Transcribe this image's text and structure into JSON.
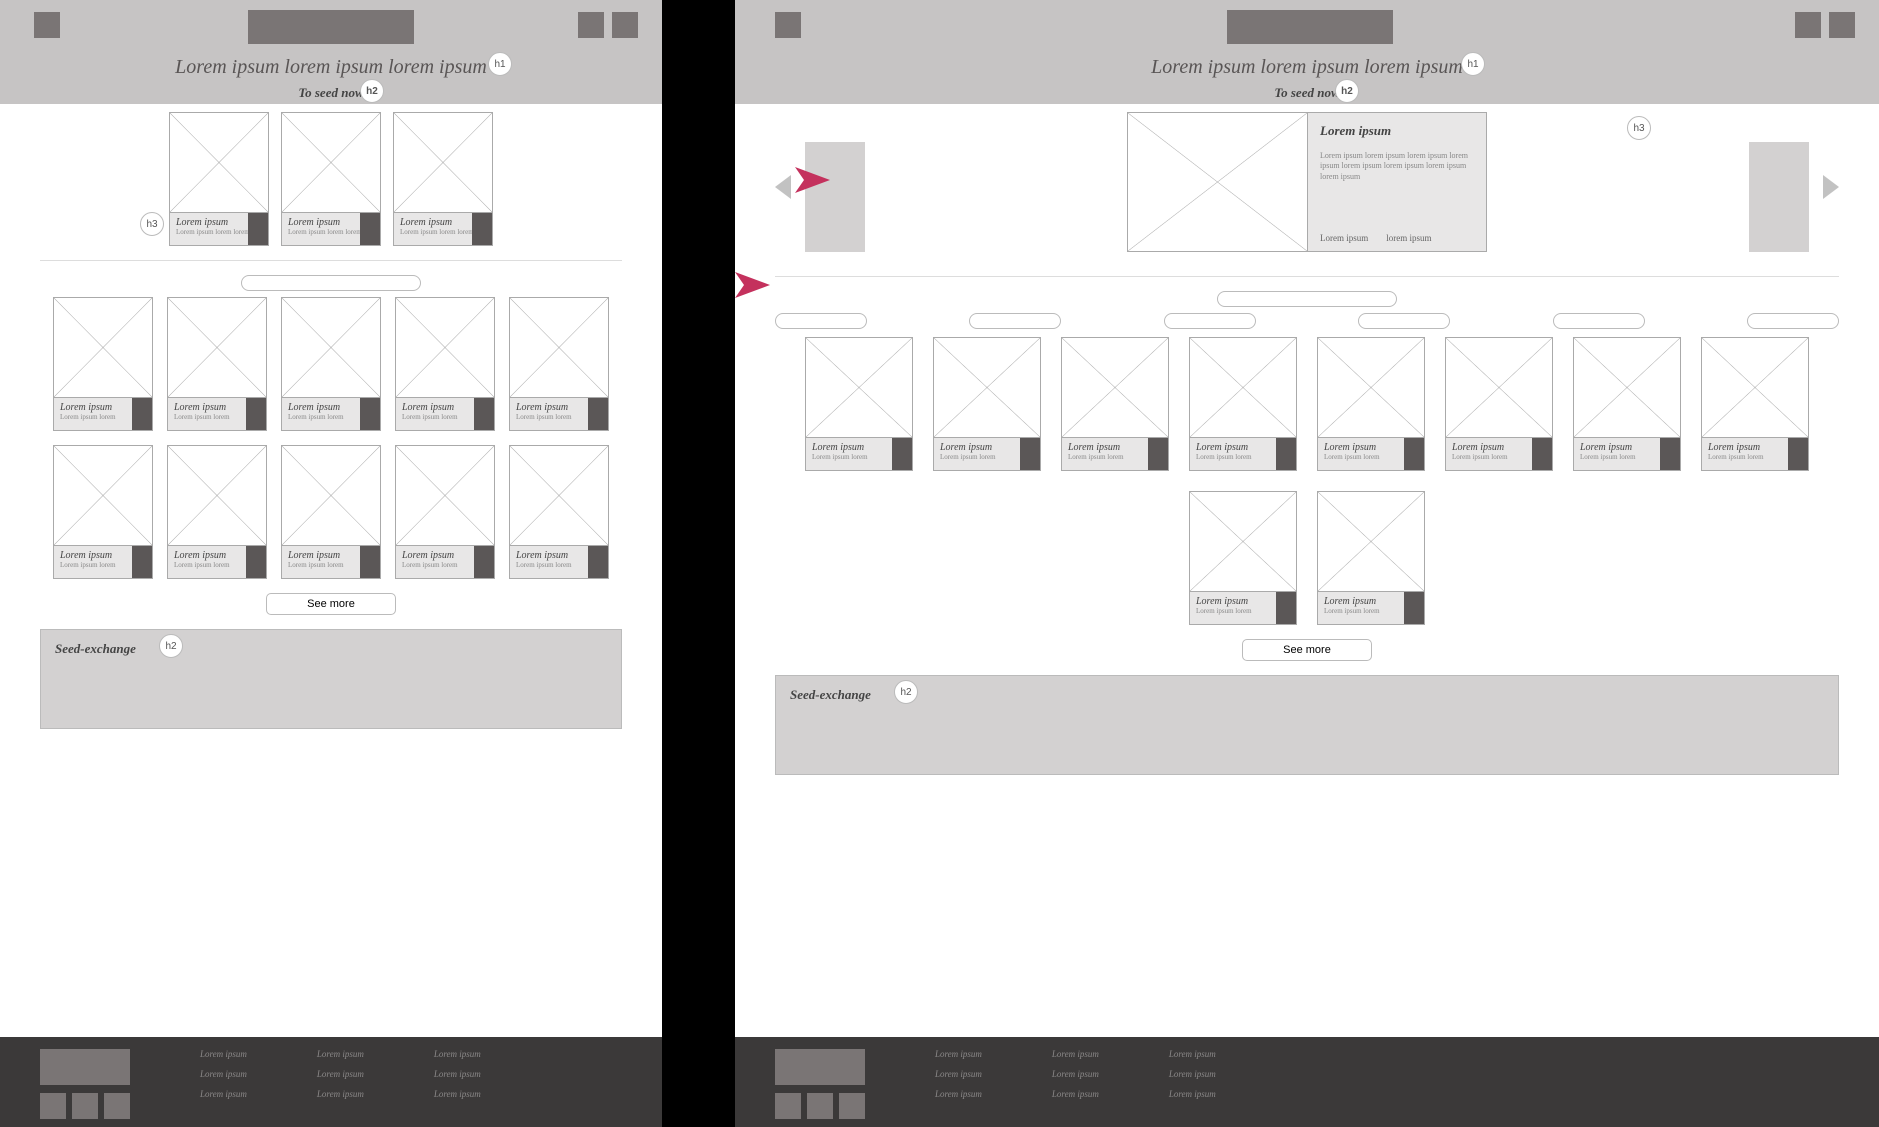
{
  "headings": {
    "h1": "Lorem ipsum lorem ipsum lorem ipsum",
    "h2_featured": "To seed now",
    "h2_section": "Seed-exchange"
  },
  "badges": {
    "h1": "h1",
    "h2": "h2",
    "h3": "h3"
  },
  "featured_card": {
    "title": "Lorem ipsum",
    "sub": "Lorem ipsum lorem lorem"
  },
  "hero": {
    "title": "Lorem ipsum",
    "desc": "Lorem ipsum lorem ipsum lorem ipsum lorem ipsum lorem ipsum lorem ipsum lorem ipsum lorem ipsum",
    "tag1": "Lorem ipsum",
    "tag2": "lorem ipsum"
  },
  "grid_card": {
    "title": "Lorem ipsum",
    "sub": "Lorem ipsum lorem"
  },
  "see_more": "See more",
  "footer_link": "Lorem ipsum"
}
